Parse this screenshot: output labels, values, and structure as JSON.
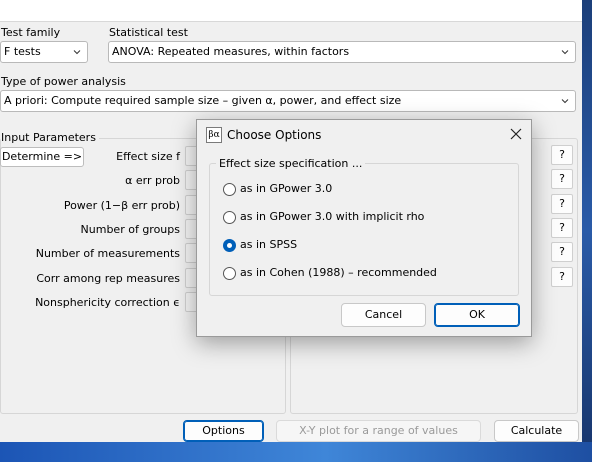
{
  "header": {
    "test_family_label": "Test family",
    "test_family_value": "F tests",
    "statistical_test_label": "Statistical test",
    "statistical_test_value": "ANOVA: Repeated measures, within factors",
    "power_analysis_label": "Type of power analysis",
    "power_analysis_value": "A priori: Compute required sample size – given α, power, and effect size"
  },
  "input_params": {
    "title": "Input Parameters",
    "determine_button": "Determine =>",
    "rows": [
      "Effect size f",
      "α err prob",
      "Power (1−β err prob)",
      "Number of groups",
      "Number of measurements",
      "Corr among rep measures",
      "Nonsphericity correction ϵ"
    ]
  },
  "help_button_label": "?",
  "bottom_buttons": {
    "options": "Options",
    "xy_plot": "X-Y plot for a range of values",
    "calculate": "Calculate"
  },
  "dialog": {
    "icon_text": "βα",
    "title": "Choose Options",
    "group_title": "Effect size specification ...",
    "options": [
      {
        "label": "as in GPower 3.0",
        "checked": false
      },
      {
        "label": "as in GPower 3.0 with implicit rho",
        "checked": false
      },
      {
        "label": "as in SPSS",
        "checked": true
      },
      {
        "label": "as in Cohen (1988) – recommended",
        "checked": false
      }
    ],
    "cancel": "Cancel",
    "ok": "OK"
  },
  "colors": {
    "accent": "#005fb8"
  }
}
